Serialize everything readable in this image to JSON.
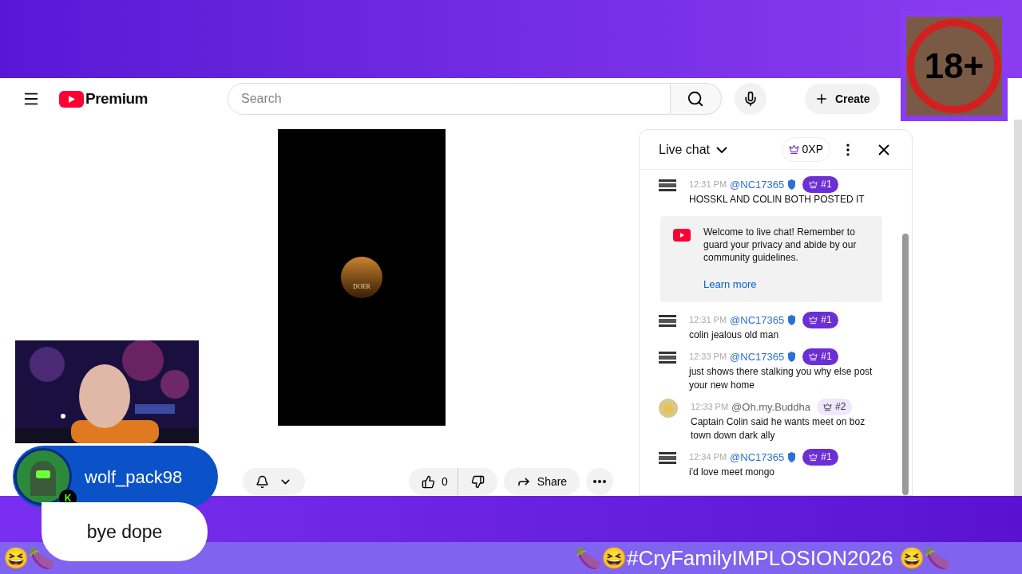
{
  "header": {
    "logo_text": "Premium",
    "search": {
      "placeholder": "Search"
    },
    "create_label": "Create"
  },
  "video": {
    "emblem_text": "DOER",
    "actions": {
      "likes": "0",
      "share": "Share"
    }
  },
  "chat": {
    "title": "Live chat",
    "xp": "0XP",
    "messages": [
      {
        "kind": "message",
        "time": "12:31 PM",
        "author": "@NC17365",
        "verified": true,
        "rank": "#1",
        "top": true,
        "text": "HOSSKL AND COLIN BOTH POSTED IT"
      },
      {
        "kind": "notice",
        "text": "Welcome to live chat! Remember to guard your privacy and abide by our community guidelines.",
        "link": "Learn more"
      },
      {
        "kind": "message",
        "time": "12:31 PM",
        "author": "@NC17365",
        "verified": true,
        "rank": "#1",
        "top": true,
        "text": "colin jealous old man"
      },
      {
        "kind": "message",
        "time": "12:33 PM",
        "author": "@NC17365",
        "verified": true,
        "rank": "#1",
        "top": true,
        "text": "just shows there stalking you why else post your new home"
      },
      {
        "kind": "message",
        "time": "12:33 PM",
        "author": "@Oh.my.Buddha",
        "verified": false,
        "rank": "#2",
        "top": false,
        "text": "Captain Colin said he wants meet on boz town down dark ally"
      },
      {
        "kind": "message",
        "time": "12:34 PM",
        "author": "@NC17365",
        "verified": true,
        "rank": "#1",
        "top": true,
        "text": "i'd love meet mongo"
      }
    ]
  },
  "overlay": {
    "age_badge": "18+",
    "alert": {
      "user": "wolf_pack98",
      "badge": "K",
      "message": "bye dope"
    }
  },
  "ticker": {
    "left": "😆🍆",
    "right": "🍆😆#CryFamilyIMPLOSION2026 😆🍆"
  }
}
